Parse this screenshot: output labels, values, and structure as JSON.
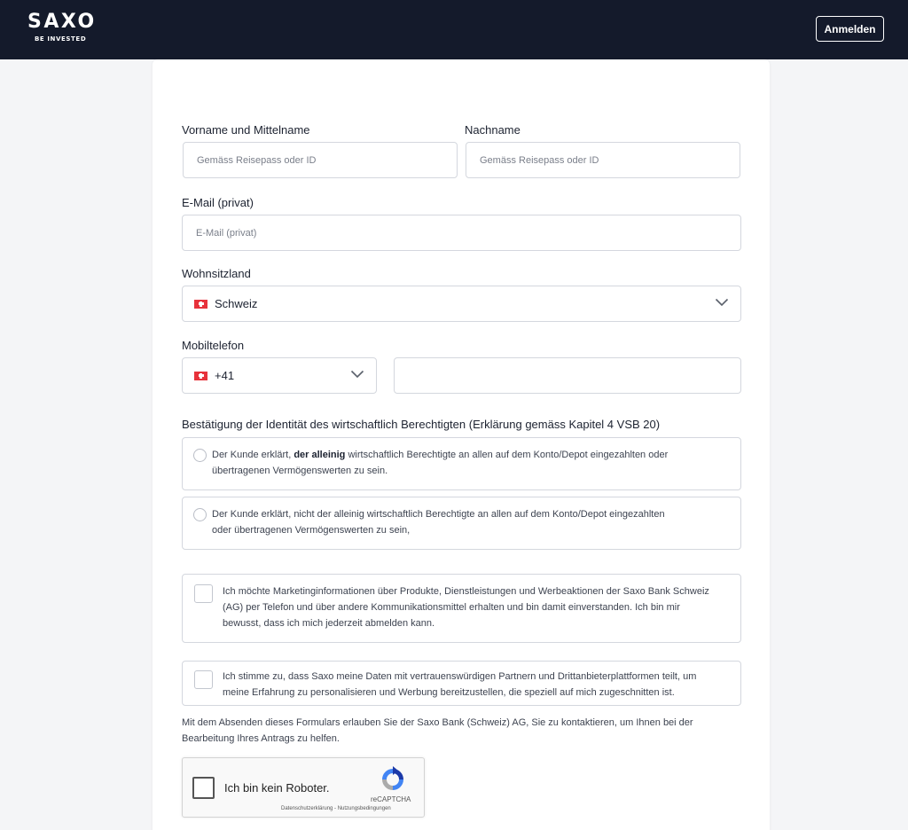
{
  "header": {
    "logo_text": "SAXO",
    "logo_tagline": "BE INVESTED",
    "login_label": "Anmelden"
  },
  "form": {
    "first_name": {
      "label": "Vorname und Mittelname",
      "placeholder": "Gemäss Reisepass oder ID",
      "value": ""
    },
    "last_name": {
      "label": "Nachname",
      "placeholder": "Gemäss Reisepass oder ID",
      "value": ""
    },
    "email": {
      "label": "E-Mail (privat)",
      "placeholder": "E-Mail (privat)",
      "value": ""
    },
    "country": {
      "label": "Wohnsitzland",
      "selected": "Schweiz",
      "flag_icon": "swiss-flag-icon"
    },
    "phone": {
      "label": "Mobiltelefon",
      "country_code": "+41",
      "number": ""
    },
    "beneficial_owner": {
      "heading": "Bestätigung der Identität des wirtschaftlich Berechtigten (Erklärung gemäss Kapitel 4 VSB 20)",
      "option1": {
        "prefix": "Der Kunde erklärt,",
        "bold": "der alleinig",
        "suffix": "wirtschaftlich Berechtigte an allen auf dem Konto/Depot eingezahlten oder",
        "line2": "übertragenen Vermögenswerten zu sein.",
        "selected": false
      },
      "option2": {
        "line1": "Der Kunde erklärt, nicht der alleinig wirtschaftlich Berechtigte an allen auf dem Konto/Depot eingezahlten",
        "line2": "oder übertragenen Vermögenswerten zu sein,",
        "selected": false
      }
    },
    "marketing_consent": {
      "line1": "Ich möchte Marketinginformationen über Produkte, Dienstleistungen und Werbeaktionen der Saxo Bank Schweiz",
      "line2": "(AG) per Telefon und über andere Kommunikationsmittel erhalten und bin damit einverstanden. Ich bin mir",
      "line3": "bewusst, dass ich mich jederzeit abmelden kann.",
      "checked": false
    },
    "partner_consent": {
      "line1": "Ich stimme zu, dass Saxo meine Daten mit vertrauenswürdigen Partnern und Drittanbieterplattformen teilt, um",
      "line2": "meine Erfahrung zu personalisieren und Werbung bereitzustellen, die speziell auf mich zugeschnitten ist.",
      "checked": false
    },
    "submit_note": {
      "line1": "Mit dem Absenden dieses Formulars erlauben Sie der Saxo Bank (Schweiz) AG, Sie zu kontaktieren, um Ihnen bei der",
      "line2": "Bearbeitung Ihres Antrags zu helfen."
    }
  },
  "captcha": {
    "label": "Ich bin kein Roboter.",
    "brand": "reCAPTCHA",
    "links": "Datenschutzerklärung - Nutzungsbedingungen",
    "checked": false
  },
  "colors": {
    "header_bg": "#141a2b",
    "page_bg": "#f4f5f7",
    "border": "#d4d7de",
    "swiss_red": "#e7323b"
  }
}
